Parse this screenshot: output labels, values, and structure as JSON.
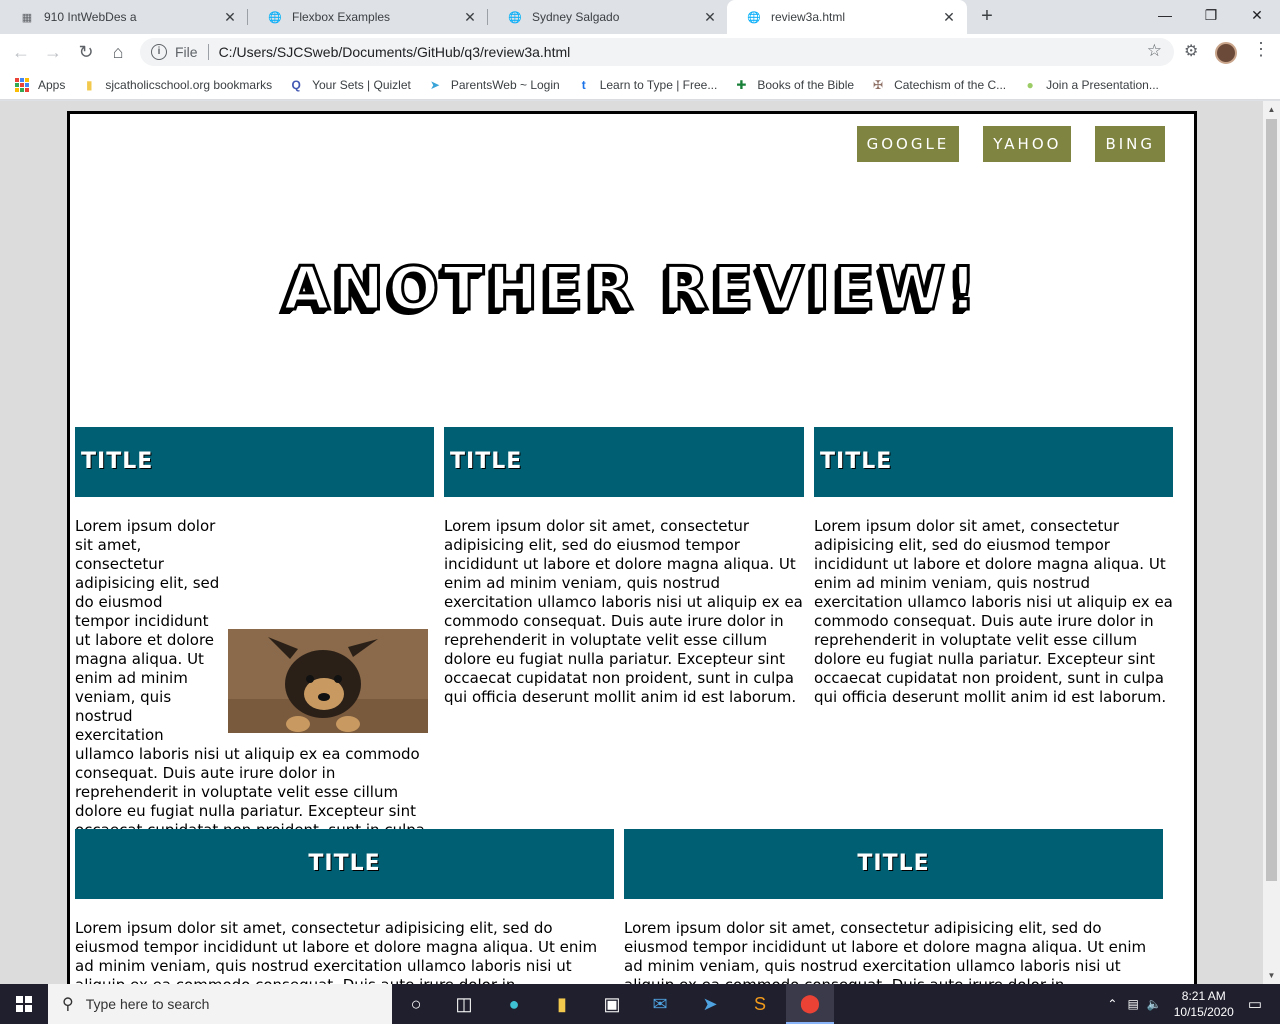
{
  "browser": {
    "tabs": [
      {
        "title": "910 IntWebDes a",
        "icon": "classroom-icon"
      },
      {
        "title": "Flexbox Examples",
        "icon": "globe-icon"
      },
      {
        "title": "Sydney Salgado",
        "icon": "globe-icon"
      },
      {
        "title": "review3a.html",
        "icon": "globe-icon"
      }
    ],
    "omnibox": {
      "scheme_label": "File",
      "url": "C:/Users/SJCSweb/Documents/GitHub/q3/review3a.html"
    },
    "bookmarks": [
      {
        "label": "Apps",
        "icon": "apps-grid-icon"
      },
      {
        "label": "sjcatholicschool.org bookmarks",
        "icon": "folder-icon"
      },
      {
        "label": "Your Sets | Quizlet",
        "icon": "quizlet-icon"
      },
      {
        "label": "ParentsWeb ~ Login",
        "icon": "parentsweb-icon"
      },
      {
        "label": "Learn to Type | Free...",
        "icon": "typing-icon"
      },
      {
        "label": "Books of the Bible",
        "icon": "bible-icon"
      },
      {
        "label": "Catechism of the C...",
        "icon": "catechism-icon"
      },
      {
        "label": "Join a Presentation...",
        "icon": "pear-icon"
      }
    ]
  },
  "page": {
    "nav": [
      "GOOGLE",
      "YAHOO",
      "BING"
    ],
    "hero_title": "ANOTHER REVIEW!",
    "cards_top": [
      {
        "title": "TITLE",
        "body": "Lorem ipsum dolor sit amet, consectetur adipisicing elit, sed do eiusmod tempor incididunt ut labore et dolore magna aliqua. Ut enim ad minim veniam, quis nostrud exercitation ullamco laboris nisi ut aliquip ex ea commodo consequat. Duis aute irure dolor in reprehenderit in voluptate velit esse cillum dolore eu fugiat nulla pariatur. Excepteur sint occaecat cupidatat non proident, sunt in culpa qui officia deserunt mollit anim id est laborum."
      },
      {
        "title": "TITLE",
        "body": "Lorem ipsum dolor sit amet, consectetur adipisicing elit, sed do eiusmod tempor incididunt ut labore et dolore magna aliqua. Ut enim ad minim veniam, quis nostrud exercitation ullamco laboris nisi ut aliquip ex ea commodo consequat. Duis aute irure dolor in reprehenderit in voluptate velit esse cillum dolore eu fugiat nulla pariatur. Excepteur sint occaecat cupidatat non proident, sunt in culpa qui officia deserunt mollit anim id est laborum."
      },
      {
        "title": "TITLE",
        "body": "Lorem ipsum dolor sit amet, consectetur adipisicing elit, sed do eiusmod tempor incididunt ut labore et dolore magna aliqua. Ut enim ad minim veniam, quis nostrud exercitation ullamco laboris nisi ut aliquip ex ea commodo consequat. Duis aute irure dolor in reprehenderit in voluptate velit esse cillum dolore eu fugiat nulla pariatur. Excepteur sint occaecat cupidatat non proident, sunt in culpa qui officia deserunt mollit anim id est laborum."
      }
    ],
    "cards_bottom": [
      {
        "title": "TITLE",
        "body": "Lorem ipsum dolor sit amet, consectetur adipisicing elit, sed do eiusmod tempor incididunt ut labore et dolore magna aliqua. Ut enim ad minim veniam, quis nostrud exercitation ullamco laboris nisi ut aliquip ex ea commodo consequat. Duis aute irure dolor in reprehenderit in voluptate velit esse cillum dolore eu fugiat nulla pariatur."
      },
      {
        "title": "TITLE",
        "body": "Lorem ipsum dolor sit amet, consectetur adipisicing elit, sed do eiusmod tempor incididunt ut labore et dolore magna aliqua. Ut enim ad minim veniam, quis nostrud exercitation ullamco laboris nisi ut aliquip ex ea commodo consequat. Duis aute irure dolor in reprehenderit in voluptate velit esse cillum dolore eu fugiat nulla pariatur."
      }
    ],
    "colors": {
      "nav_button": "#7f8540",
      "card_header": "#005f73"
    }
  },
  "taskbar": {
    "search_placeholder": "Type here to search",
    "time": "8:21 AM",
    "date": "10/15/2020"
  }
}
